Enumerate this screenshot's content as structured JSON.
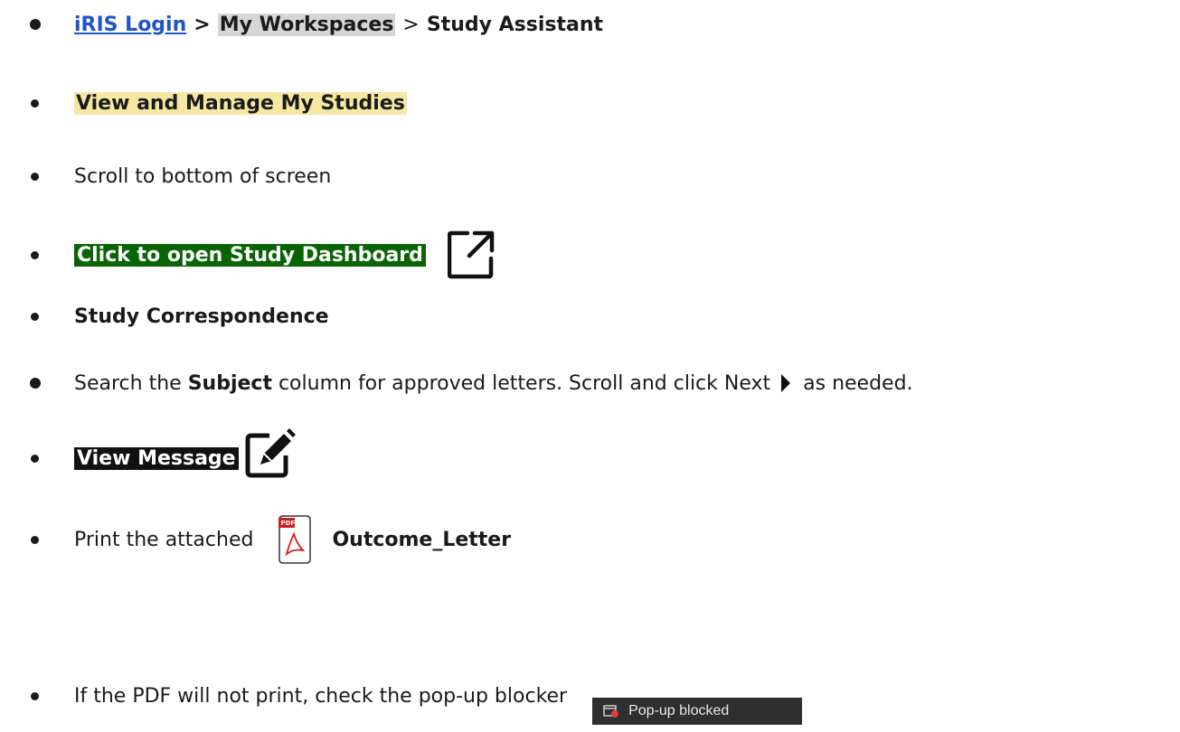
{
  "breadcrumb": {
    "link": "iRIS Login",
    "sep1": ">",
    "workspaces": "My Workspaces",
    "sep2": ">",
    "assistant": "Study Assistant"
  },
  "step2": {
    "label": "View and Manage My Studies"
  },
  "step3": {
    "text": "Scroll to bottom of screen"
  },
  "step4": {
    "label": "Click to open Study Dashboard",
    "icon": "external-link-icon"
  },
  "step5": {
    "label": "Study Correspondence"
  },
  "step6": {
    "pre": "Search the ",
    "bold": "Subject",
    "mid": " column for approved letters. Scroll and click Next ",
    "post": " as needed.",
    "icon": "play-triangle-icon"
  },
  "step7": {
    "label": "View Message",
    "icon": "edit-icon"
  },
  "step8": {
    "pre": "Print the attached ",
    "file": "Outcome_Letter",
    "icon_badge": "PDF"
  },
  "step9": {
    "text": "If the PDF will not print, check the pop-up blocker",
    "popup_label": "Pop-up blocked"
  },
  "colors": {
    "link": "#1f55c9",
    "yellow": "#f6e7a3",
    "gray": "#d6d6d6",
    "green": "#096404",
    "black": "#111111",
    "popup_bg": "#2f2f2f",
    "pdf_red": "#cc1f1f"
  }
}
